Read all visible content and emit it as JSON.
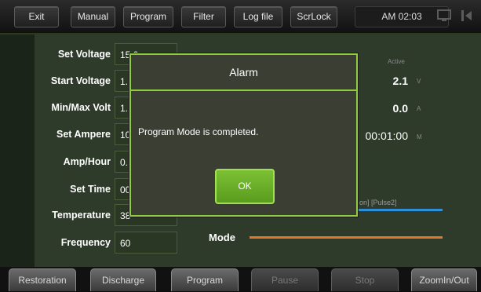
{
  "toolbar": {
    "exit": "Exit",
    "manual": "Manual",
    "program": "Program",
    "filter": "Filter",
    "log_file": "Log file",
    "scrlock": "ScrLock",
    "clock": "AM 02:03",
    "icons": [
      "monitor-icon",
      "arrow-right-icon"
    ]
  },
  "settings": [
    {
      "label": "Set Voltage",
      "value": "15.0"
    },
    {
      "label": "Start Voltage",
      "value": "1."
    },
    {
      "label": "Min/Max Volt",
      "value": "1."
    },
    {
      "label": "Set Ampere",
      "value": "10"
    },
    {
      "label": "Amp/Hour",
      "value": "0."
    },
    {
      "label": "Set Time",
      "value": "00"
    },
    {
      "label": "Temperature",
      "value": "38"
    },
    {
      "label": "Frequency",
      "value": "60"
    }
  ],
  "readout": {
    "active_label": "Active",
    "voltage": "2.1",
    "voltage_unit": "V",
    "ampere": "0.0",
    "ampere_unit": "A",
    "time": "00:01:00",
    "time_unit": "M"
  },
  "graph": {
    "pulse_label": "on]  [Pulse2]",
    "mode_label": "Mode",
    "line1_color": "#2f8fd8",
    "line2_color": "#e07a2a"
  },
  "dialog": {
    "title": "Alarm",
    "message": "Program Mode is completed.",
    "ok_label": "OK"
  },
  "bottom": {
    "restoration": "Restoration",
    "discharge": "Discharge",
    "program": "Program",
    "pause": "Pause",
    "stop": "Stop",
    "zoom": "ZoomIn/Out"
  }
}
